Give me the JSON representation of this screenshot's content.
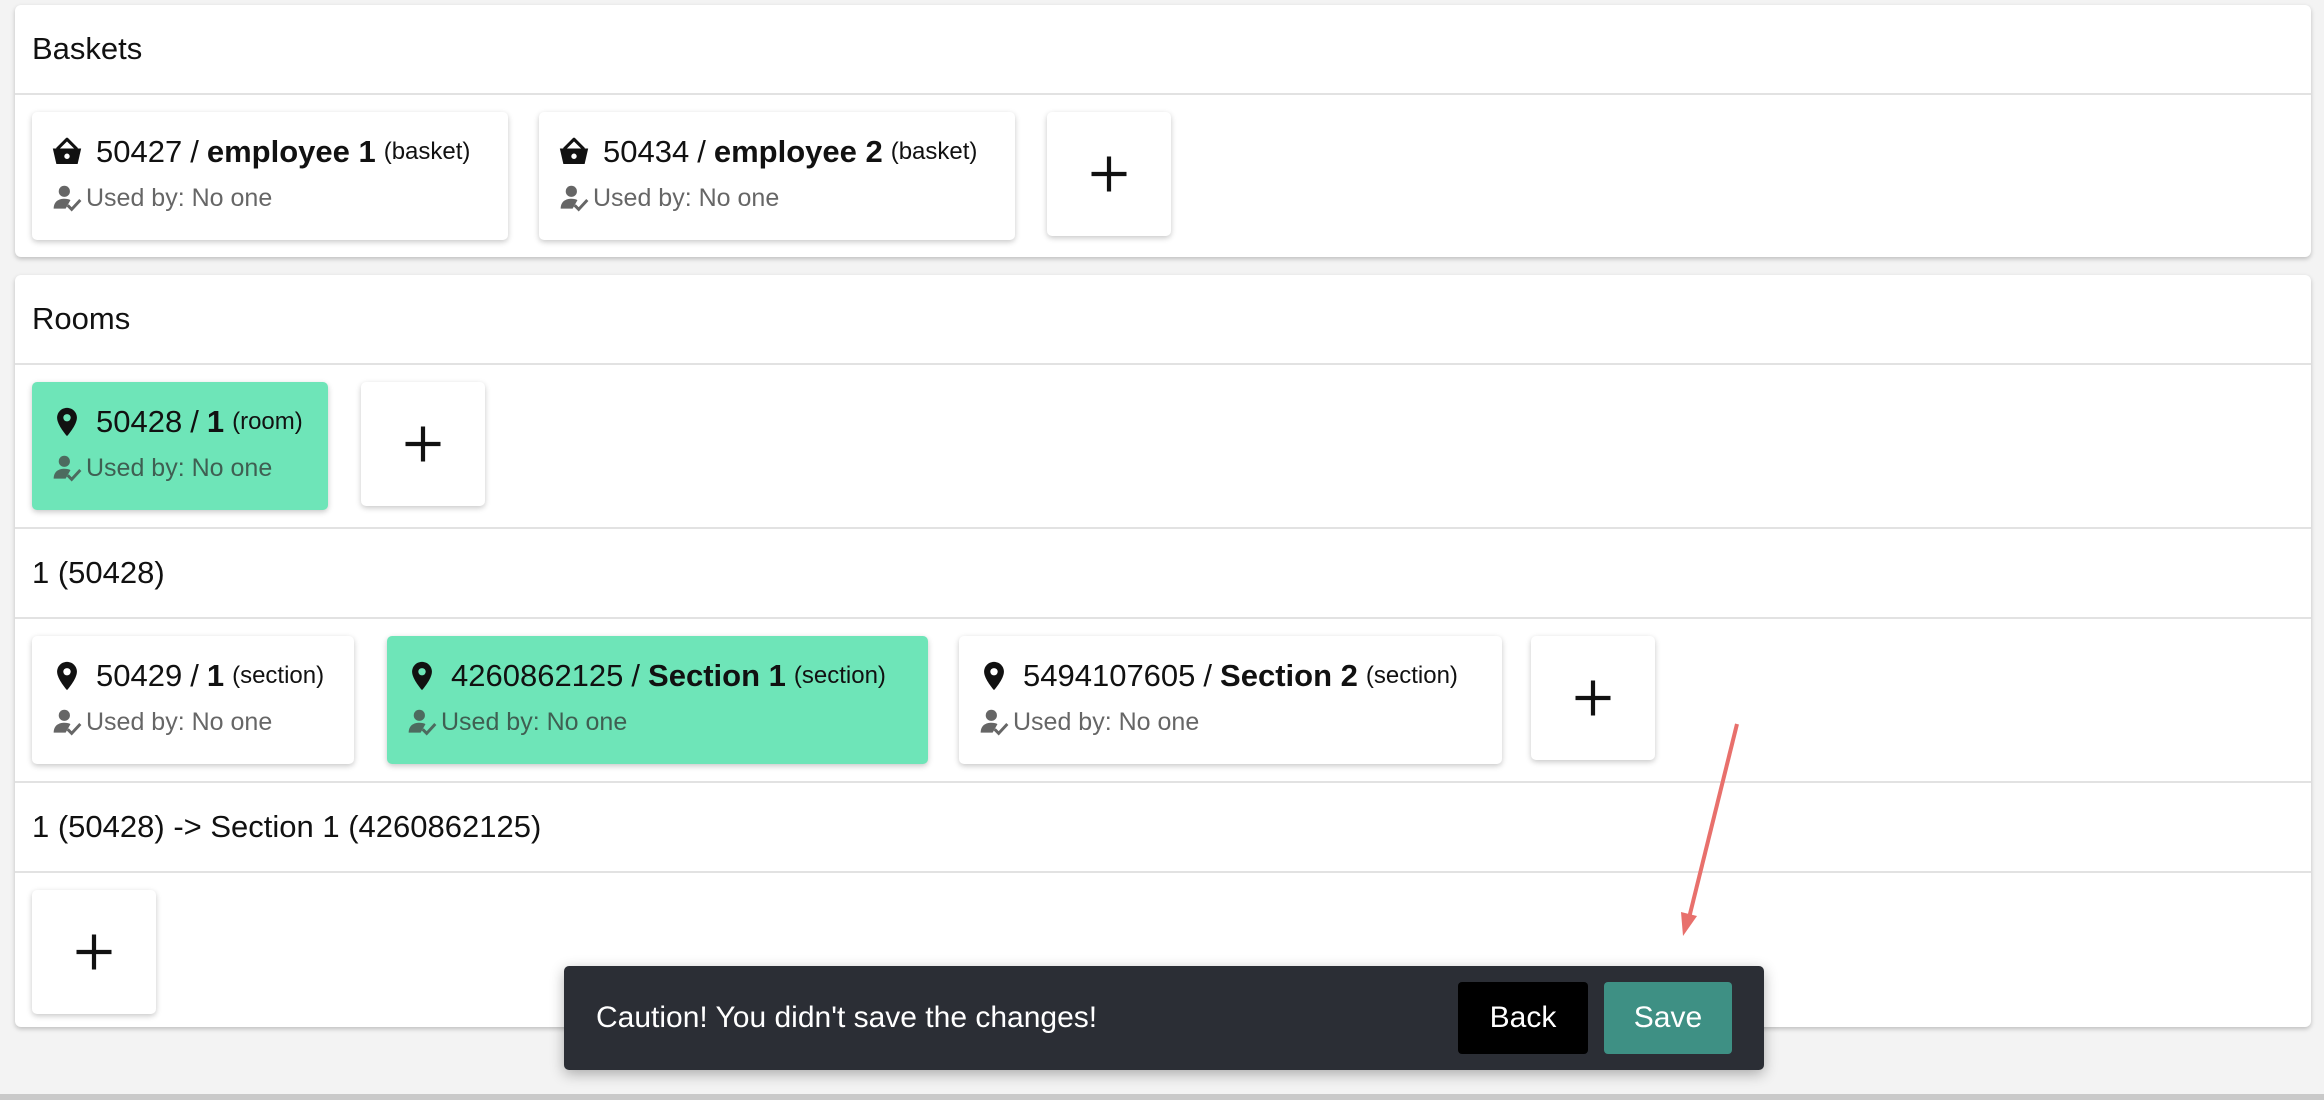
{
  "baskets": {
    "title": "Baskets",
    "cards": [
      {
        "id": "50427",
        "name": "employee 1",
        "type": "(basket)",
        "usage": "Used by: No one",
        "icon": "basket-icon",
        "selected": false
      },
      {
        "id": "50434",
        "name": "employee 2",
        "type": "(basket)",
        "usage": "Used by: No one",
        "icon": "basket-icon",
        "selected": false
      }
    ]
  },
  "rooms": {
    "title": "Rooms",
    "cards": [
      {
        "id": "50428",
        "name": "1",
        "type": "(room)",
        "usage": "Used by: No one",
        "icon": "location-pin-icon",
        "selected": true
      }
    ],
    "groups": [
      {
        "title": "1 (50428)",
        "cards": [
          {
            "id": "50429",
            "name": "1",
            "type": "(section)",
            "usage": "Used by: No one",
            "icon": "location-pin-icon",
            "selected": false
          },
          {
            "id": "4260862125",
            "name": "Section 1",
            "type": "(section)",
            "usage": "Used by: No one",
            "icon": "location-pin-icon",
            "selected": true
          },
          {
            "id": "5494107605",
            "name": "Section 2",
            "type": "(section)",
            "usage": "Used by: No one",
            "icon": "location-pin-icon",
            "selected": false
          }
        ]
      },
      {
        "title": "1 (50428) -> Section 1 (4260862125)",
        "cards": []
      }
    ]
  },
  "separator": "/",
  "icons": {
    "add": "plus-icon",
    "usage": "user-check-icon"
  },
  "toast": {
    "message": "Caution! You didn't save the changes!",
    "back_label": "Back",
    "save_label": "Save"
  },
  "colors": {
    "selected": "#6ee5b8",
    "toast_bg": "#2b2e35",
    "save_button": "#3e9084",
    "back_button": "#000000",
    "annotation_arrow": "#e8706c"
  }
}
